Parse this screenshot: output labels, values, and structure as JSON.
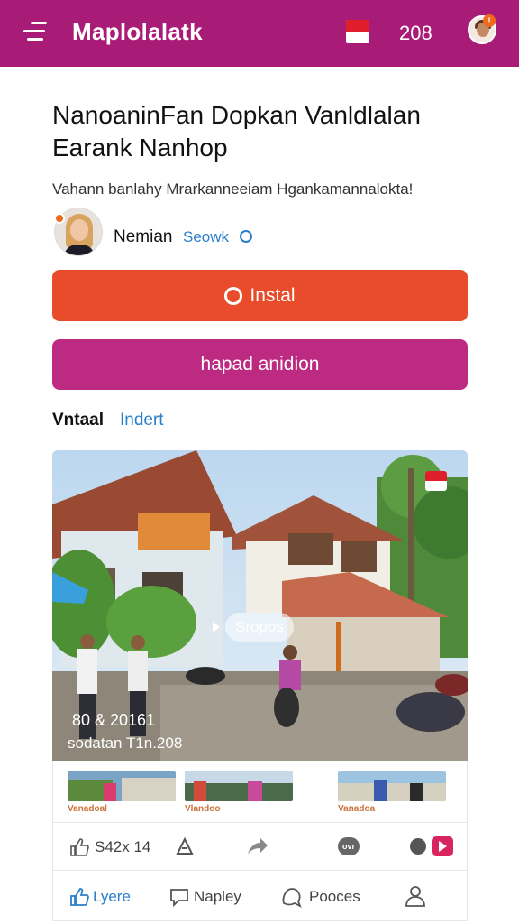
{
  "header": {
    "title": "Maplolalatk",
    "count": "208",
    "notification_badge": "!",
    "icons": [
      "menu-icon",
      "flag-icon",
      "avatar"
    ]
  },
  "article": {
    "title_line1": "NanoaninFan Dopkan Vanldlalan",
    "title_line2": "Earank Nanhop",
    "subtitle": "Vahann banlahy Mrarkanneeiam Hgankamannalokta!"
  },
  "author": {
    "name": "Nemian",
    "link": "Seowk"
  },
  "buttons": {
    "install": "Instal",
    "secondary": "hapad anidion"
  },
  "section": {
    "label": "Vntaal",
    "link": "Indert"
  },
  "photo": {
    "pill_label": "Sropos",
    "date": "80 & 20161",
    "caption": "sodatan T1n.208"
  },
  "thumbnails": [
    {
      "label": "Vanadoal"
    },
    {
      "label": "Vlandoo"
    },
    {
      "label": "Vanadoa"
    }
  ],
  "actions": {
    "likes": "S42x 14",
    "icons": [
      "thumbs-up-icon",
      "diamond-icon",
      "share-icon",
      "more-icon",
      "record-icon"
    ]
  },
  "bottom_nav": {
    "like": "Lyere",
    "reply": "Napley",
    "posts": "Pooces",
    "profile_icon": "user-icon"
  },
  "colors": {
    "header": "#a81c78",
    "install_button": "#e84c2a",
    "secondary_button": "#bd2a81",
    "link": "#2a7fc9"
  }
}
